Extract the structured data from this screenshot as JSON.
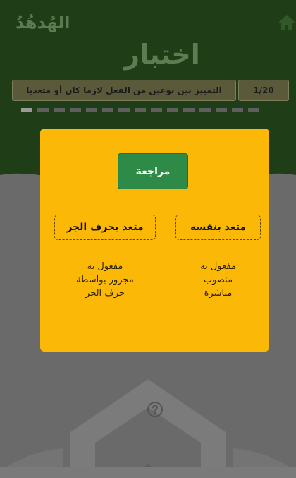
{
  "header": {
    "brand": "الهُدهُدُ",
    "title": "اختبار"
  },
  "question": {
    "text": "التمييز بين نوعين من الفعل لازما كان أو متعديا",
    "counter": "1/20",
    "progress_total": 15,
    "progress_current": 1
  },
  "modal": {
    "review_label": "مراجعة",
    "choices": [
      {
        "label": "متعد بنفسه",
        "description": [
          "مفعول به",
          "منصوب",
          "مباشرة"
        ]
      },
      {
        "label": "متعد بحرف الجر",
        "description": [
          "مفعول به",
          "مجرور بواسطة",
          "حرف الجر"
        ]
      }
    ]
  },
  "icons": {
    "home": "home-icon",
    "help": "question-circle-icon"
  },
  "colors": {
    "header_green": "#1f3d17",
    "modal_yellow": "#fbb806",
    "review_green": "#2e8b47",
    "overlay_gray": "#6a6a6a"
  }
}
